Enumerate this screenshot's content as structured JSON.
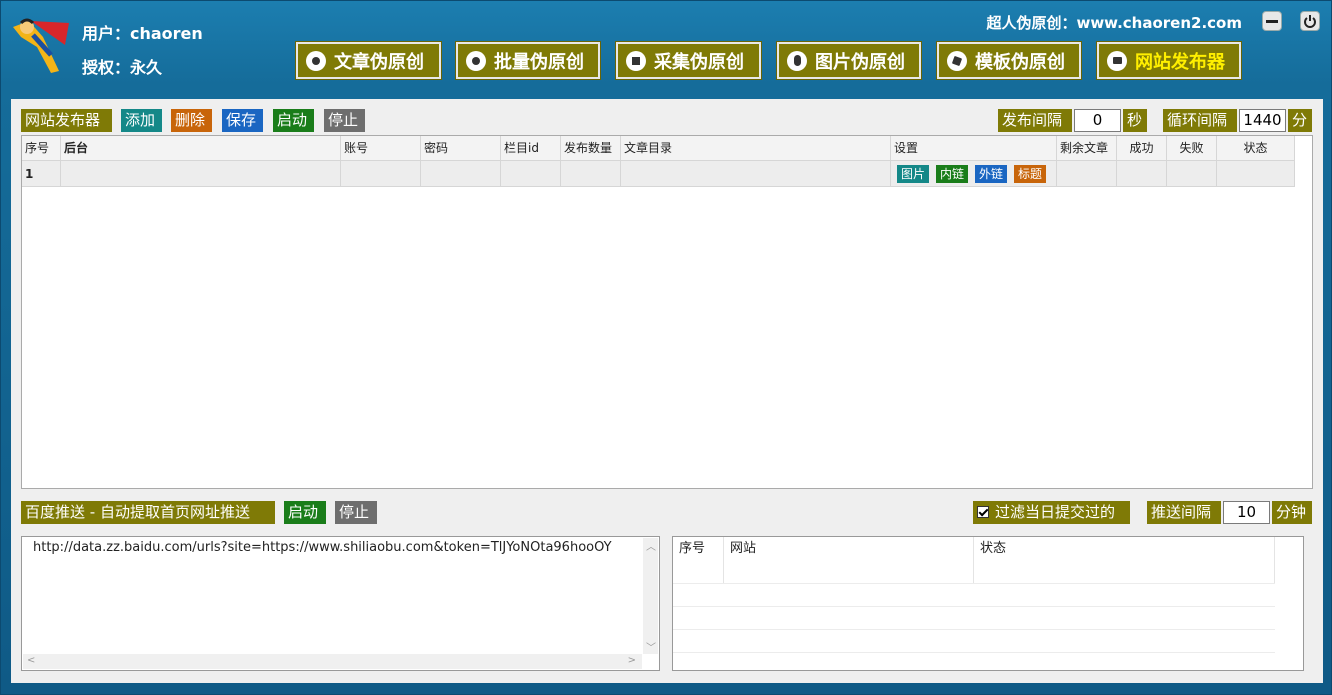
{
  "header": {
    "user_label": "用户：chaoren",
    "license_label": "授权：永久",
    "site_label": "超人伪原创：www.chaoren2.com"
  },
  "nav": [
    {
      "label": "文章伪原创",
      "icon": "disc-icon"
    },
    {
      "label": "批量伪原创",
      "icon": "disc-icon"
    },
    {
      "label": "采集伪原创",
      "icon": "stop-icon"
    },
    {
      "label": "图片伪原创",
      "icon": "mouse-icon"
    },
    {
      "label": "模板伪原创",
      "icon": "cube-icon"
    },
    {
      "label": "网站发布器",
      "icon": "book-icon",
      "active": true
    }
  ],
  "publisher": {
    "title": "网站发布器",
    "add": "添加",
    "delete": "删除",
    "save": "保存",
    "start": "启动",
    "stop": "停止",
    "interval_label": "发布间隔",
    "interval_value": "0",
    "interval_unit": "秒",
    "loop_label": "循环间隔",
    "loop_value": "1440",
    "loop_unit": "分"
  },
  "table": {
    "headers": [
      "序号",
      "后台",
      "账号",
      "密码",
      "栏目id",
      "发布数量",
      "文章目录",
      "设置",
      "剩余文章",
      "成功",
      "失败",
      "状态"
    ],
    "rows": [
      {
        "index": "1",
        "backend": "",
        "account": "",
        "password": "",
        "column_id": "",
        "count": "",
        "dir": "",
        "remaining": "",
        "success": "",
        "fail": "",
        "status": ""
      }
    ],
    "setting_buttons": [
      "图片",
      "内链",
      "外链",
      "标题"
    ]
  },
  "baidu": {
    "title": "百度推送 - 自动提取首页网址推送",
    "start": "启动",
    "stop": "停止",
    "filter_label": "过滤当日提交过的",
    "filter_checked": true,
    "push_label": "推送间隔",
    "push_value": "10",
    "push_unit": "分钟",
    "api_text": "http://data.zz.baidu.com/urls?site=https://www.shiliaobu.com&token=TlJYoNOta96hooOY",
    "columns": [
      "序号",
      "网站",
      "状态"
    ]
  },
  "colors": {
    "titlebar": "#156c9a",
    "olive": "#7f7a06",
    "active_text": "#ffef00"
  }
}
